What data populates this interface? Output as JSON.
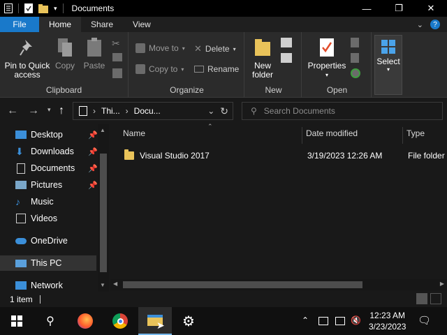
{
  "window": {
    "title": "Documents",
    "minimize_glyph": "—",
    "maximize_glyph": "❐",
    "close_glyph": "✕"
  },
  "ribbon_tabs": {
    "file": "File",
    "home": "Home",
    "share": "Share",
    "view": "View"
  },
  "ribbon": {
    "clipboard": {
      "label": "Clipboard",
      "pin_line1": "Pin to Quick",
      "pin_line2": "access",
      "copy": "Copy",
      "paste": "Paste"
    },
    "organize": {
      "label": "Organize",
      "move_to": "Move to",
      "copy_to": "Copy to",
      "delete": "Delete",
      "rename": "Rename"
    },
    "new": {
      "label": "New",
      "new_folder_line1": "New",
      "new_folder_line2": "folder"
    },
    "open": {
      "label": "Open",
      "properties": "Properties"
    },
    "select": {
      "label": "Select"
    }
  },
  "address": {
    "crumb1": "Thi...",
    "crumb2": "Docu...",
    "search_placeholder": "Search Documents"
  },
  "sidebar": {
    "items": [
      {
        "label": "Desktop",
        "icon": "desktop-icon",
        "pinned": true
      },
      {
        "label": "Downloads",
        "icon": "downloads-icon",
        "pinned": true
      },
      {
        "label": "Documents",
        "icon": "documents-icon",
        "pinned": true
      },
      {
        "label": "Pictures",
        "icon": "pictures-icon",
        "pinned": true
      },
      {
        "label": "Music",
        "icon": "music-icon",
        "pinned": false
      },
      {
        "label": "Videos",
        "icon": "videos-icon",
        "pinned": false
      },
      {
        "label": "OneDrive",
        "icon": "onedrive-icon",
        "pinned": false
      },
      {
        "label": "This PC",
        "icon": "this-pc-icon",
        "pinned": false
      },
      {
        "label": "Network",
        "icon": "network-icon",
        "pinned": false
      }
    ]
  },
  "columns": {
    "name": "Name",
    "date_modified": "Date modified",
    "type": "Type"
  },
  "files": [
    {
      "name": "Visual Studio 2017",
      "date_modified": "3/19/2023 12:26 AM",
      "type": "File folder"
    }
  ],
  "status": {
    "item_count": "1 item"
  },
  "taskbar": {
    "time": "12:23 AM",
    "date": "3/23/2023"
  },
  "colors": {
    "accent": "#1979ca",
    "folder": "#e9c35a",
    "background": "#191919"
  }
}
